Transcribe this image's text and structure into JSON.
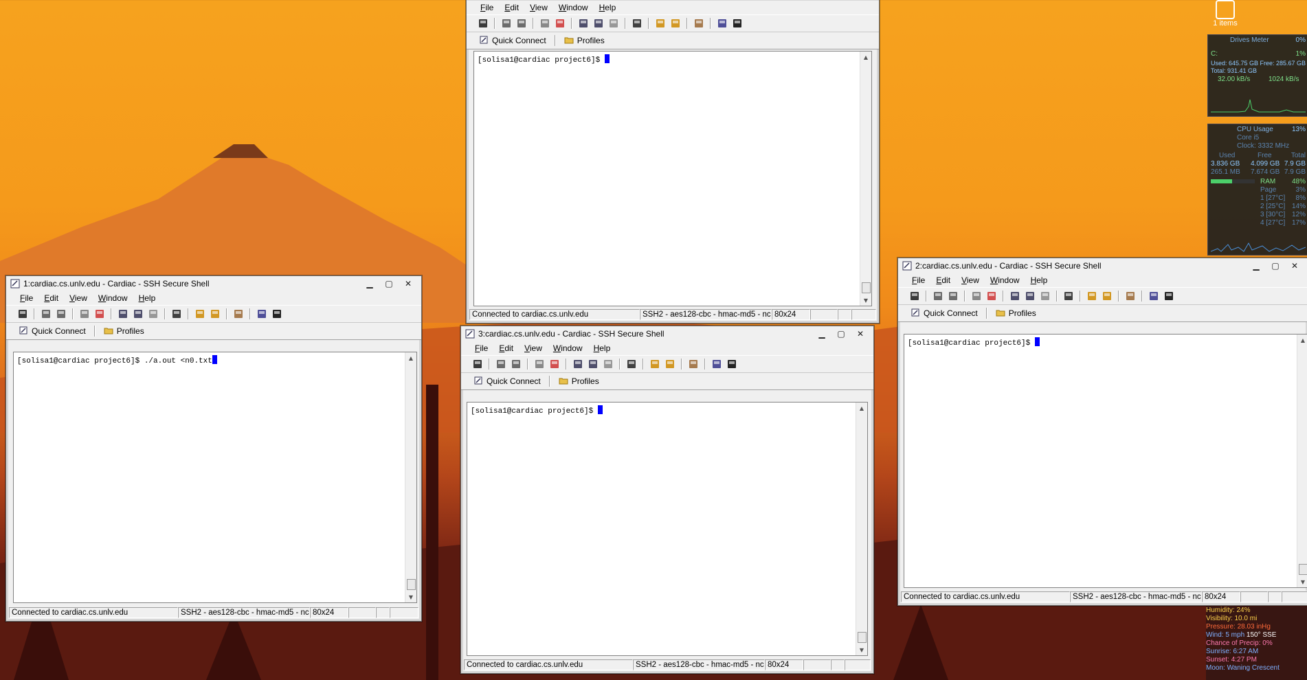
{
  "desktop": {
    "icon_label": "1 items"
  },
  "menu": [
    "File",
    "Edit",
    "View",
    "Window",
    "Help"
  ],
  "quick": {
    "connect": "Quick Connect",
    "profiles": "Profiles"
  },
  "windows": {
    "w1": {
      "title": "1:cardiac.cs.unlv.edu - Cardiac - SSH Secure Shell",
      "prompt": "[solisa1@cardiac project6]$ ./a.out <n0.txt",
      "status": {
        "connection": "Connected to cardiac.cs.unlv.edu",
        "cipher": "SSH2 - aes128-cbc - hmac-md5 - nc",
        "size": "80x24"
      }
    },
    "w2": {
      "title": "2:cardiac.cs.unlv.edu - Cardiac - SSH Secure Shell",
      "prompt": "[solisa1@cardiac project6]$ ",
      "status": {
        "connection": "Connected to cardiac.cs.unlv.edu",
        "cipher": "SSH2 - aes128-cbc - hmac-md5 - nc",
        "size": "80x24"
      }
    },
    "w3": {
      "title": "3:cardiac.cs.unlv.edu - Cardiac - SSH Secure Shell",
      "prompt": "[solisa1@cardiac project6]$ ",
      "status": {
        "connection": "Connected to cardiac.cs.unlv.edu",
        "cipher": "SSH2 - aes128-cbc - hmac-md5 - nc",
        "size": "80x24"
      }
    },
    "w4": {
      "prompt": "[solisa1@cardiac project6]$ ",
      "status": {
        "connection": "Connected to cardiac.cs.unlv.edu",
        "cipher": "SSH2 - aes128-cbc - hmac-md5 - nc",
        "size": "80x24"
      }
    }
  },
  "drives_meter": {
    "title": "Drives Meter",
    "pct": "0%",
    "drive": "C:",
    "drive_pct": "1%",
    "used": "Used: 645.75 GB",
    "free": "Free: 285.67 GB",
    "total": "Total: 931.41 GB",
    "read": "32.00 kB/s",
    "write": "1024 kB/s"
  },
  "cpu_usage": {
    "title": "CPU Usage",
    "pct": "13%",
    "core": "Core i5",
    "clock": "Clock: 3332 MHz",
    "hdr_used": "Used",
    "hdr_free": "Free",
    "hdr_total": "Total",
    "ram_row": [
      "3.836 GB",
      "4.099 GB",
      "7.9 GB"
    ],
    "page_row": [
      "265.1 MB",
      "7.674 GB",
      "7.9 GB"
    ],
    "ram_label": "RAM",
    "ram_pct": "48%",
    "page_label": "Page",
    "page_pct": "3%",
    "cores": [
      {
        "label": "1 [27°C]",
        "pct": "8%"
      },
      {
        "label": "2 [25°C]",
        "pct": "14%"
      },
      {
        "label": "3 [30°C]",
        "pct": "12%"
      },
      {
        "label": "4 [27°C]",
        "pct": "17%"
      }
    ],
    "ram_fill": 0.48
  },
  "weather": {
    "humidity": "Humidity: 24%",
    "visibility": "Visibility: 10.0 mi",
    "pressure": "Pressure: 28.03 inHg",
    "wind": "Wind: 5 mph",
    "wind_dir": "150° SSE",
    "precip": "Chance of Precip: 0%",
    "sunrise": "Sunrise: 6:27 AM",
    "sunset": "Sunset: 4:27 PM",
    "moon": "Moon: Waning Crescent"
  }
}
